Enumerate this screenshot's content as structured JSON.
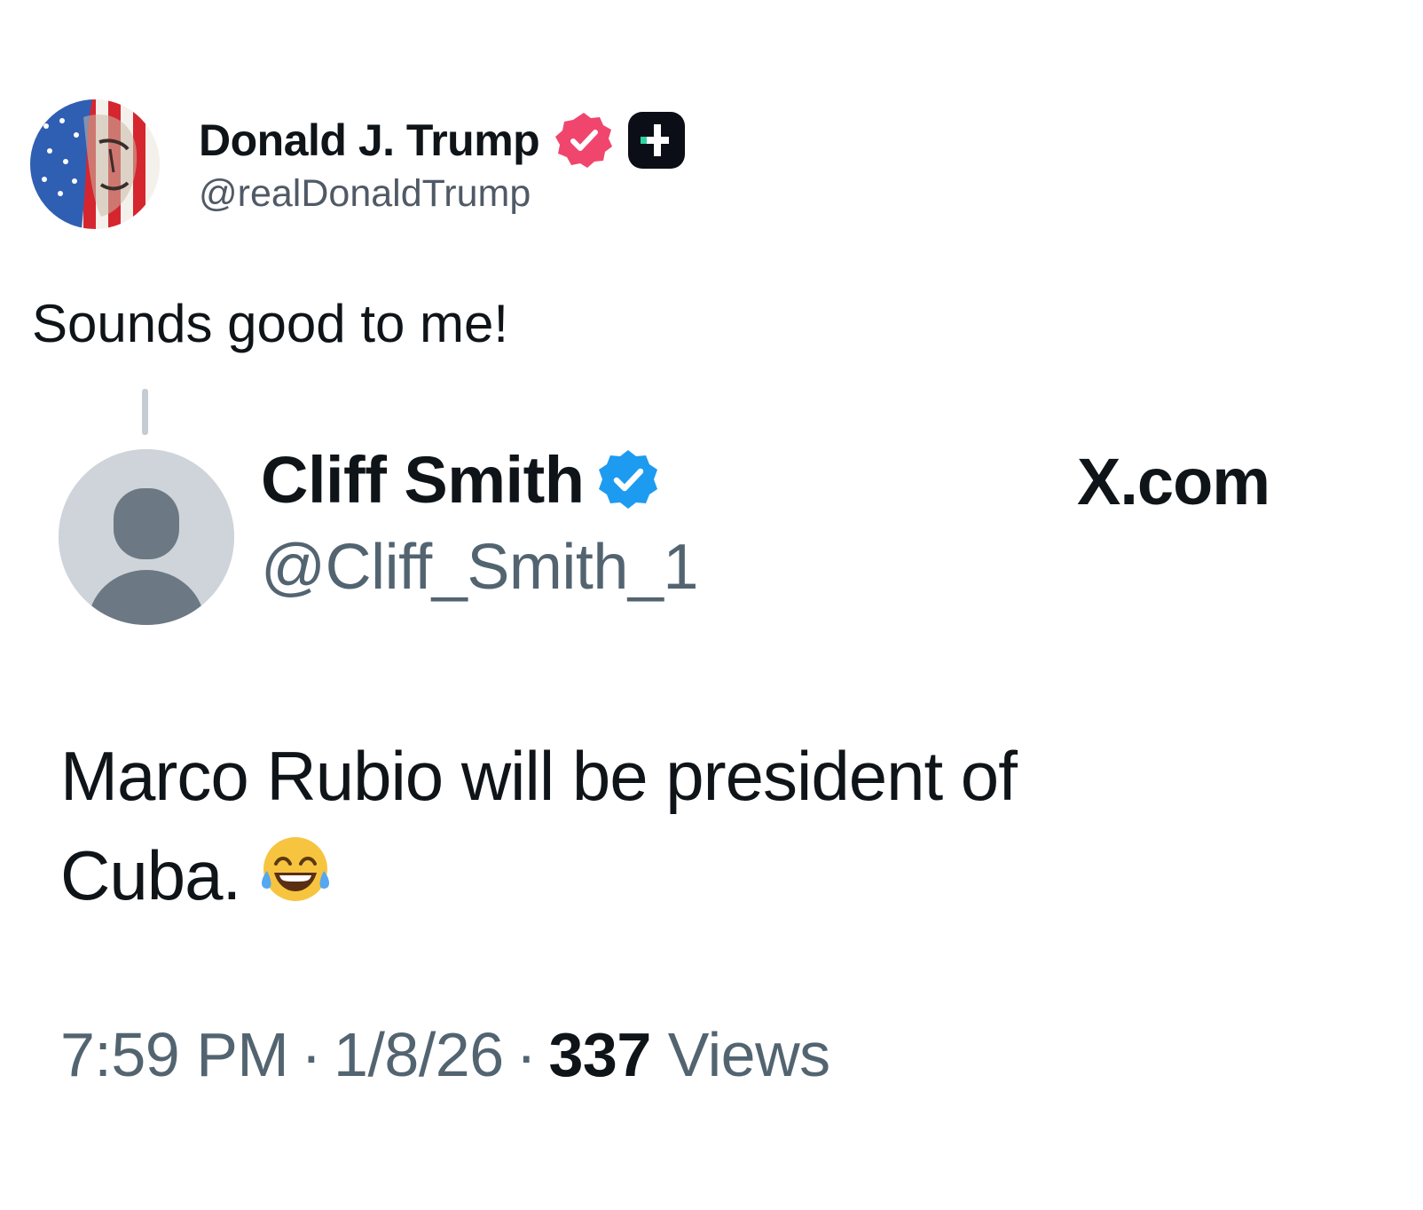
{
  "post": {
    "author": {
      "display_name": "Donald J. Trump",
      "handle": "@realDonaldTrump",
      "avatar_icon": "flag-portrait-avatar",
      "badges": [
        "verified-badge-icon",
        "truth-plus-icon"
      ],
      "badge_color": "#f0466d"
    },
    "text": "Sounds good to me!"
  },
  "quoted": {
    "author": {
      "display_name": "Cliff Smith",
      "handle": "@Cliff_Smith_1",
      "avatar_icon": "default-profile-avatar",
      "badge_color": "#1d9bf0"
    },
    "source": "X.com",
    "text_lines": [
      "Marco Rubio will be president of",
      "Cuba."
    ],
    "emoji": "face-with-tears-of-joy",
    "time": "7:59 PM",
    "date": "1/8/26",
    "separator": "·",
    "views_count": "337",
    "views_label": "Views"
  }
}
